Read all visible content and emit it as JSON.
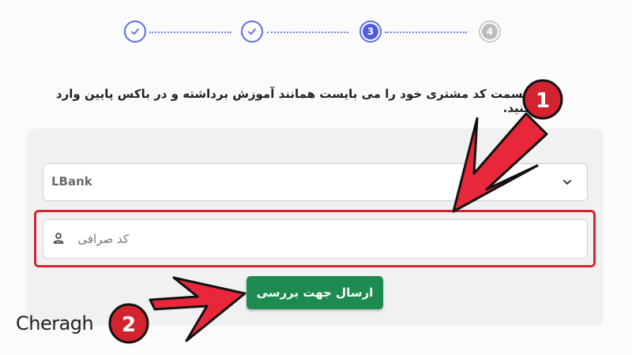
{
  "stepper": {
    "steps": [
      {
        "status": "done"
      },
      {
        "status": "done"
      },
      {
        "status": "active",
        "label": "3"
      },
      {
        "status": "pending",
        "label": "4"
      }
    ]
  },
  "instruction": "قسمت کد مشتری خود را می بایست همانند آموزش برداشته و در باکس پایین وارد کنید.",
  "form": {
    "exchange_select": {
      "value": "LBank"
    },
    "code_input": {
      "placeholder": "کد صرافی",
      "value": ""
    },
    "submit_label": "ارسال جهت بررسی"
  },
  "annotations": {
    "badge_1": "1",
    "badge_2": "2",
    "highlight_color": "#d3232f"
  },
  "logo": {
    "text": "Cheragh"
  },
  "colors": {
    "accent": "#5c6fe0",
    "button": "#1d8a4f",
    "card_bg": "#f1f1f1"
  }
}
